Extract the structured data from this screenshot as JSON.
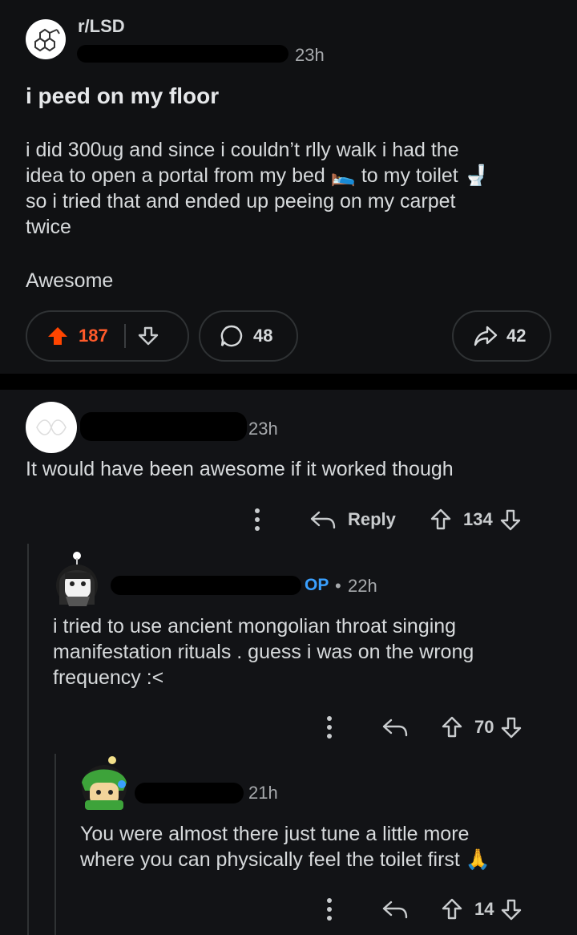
{
  "post": {
    "subreddit": "r/LSD",
    "time": "23h",
    "title": "i peed on my floor",
    "body_lines": [
      "i did 300ug and since i couldn’t rlly walk i had the",
      "idea to open a portal from my bed 🛌 to my toilet 🚽",
      "so i tried that and ended up peeing on my carpet",
      "twice"
    ],
    "body_extra": "Awesome",
    "upvotes": "187",
    "comments": "48",
    "shares": "42"
  },
  "comments": [
    {
      "time": "23h",
      "text": "It would have been awesome if it worked though",
      "reply_label": "Reply",
      "score": "134"
    },
    {
      "op_badge": "OP",
      "dot": "•",
      "time": "22h",
      "text_lines": [
        "i tried to use ancient mongolian throat singing",
        "manifestation rituals . guess i was on the wrong",
        "frequency :<"
      ],
      "score": "70"
    },
    {
      "time": "21h",
      "text_lines": [
        "You were almost there just tune a little more",
        "where you can physically feel the toilet first 🙏"
      ],
      "score": "14"
    }
  ],
  "colors": {
    "upvote": "#ff4500",
    "op": "#3aa0ff"
  }
}
